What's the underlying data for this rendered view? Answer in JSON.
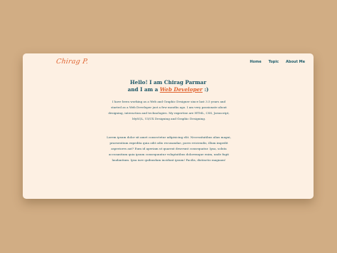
{
  "brand": {
    "logo": "Chirag P."
  },
  "nav": {
    "items": [
      "Home",
      "Topic",
      "About Me"
    ]
  },
  "hero": {
    "line1": "Hello! I am Chirag Parmar",
    "line2_prefix": "and I am a",
    "role": "Web Developer",
    "line2_suffix": ":)"
  },
  "content": {
    "paragraph1": "I have been working as a Web and Graphic Designer since last 3.5 years and started as a Web Developer just a few months ago. I am very passionate about designing, interaction and technologies. My expertise are HTML, CSS, Javascript, MySQL, UI/UX Designing and Graphic Designing.",
    "paragraph2": "Lorem ipsum dolor sit amet consectetur adipisicing elit. Necessitatibus alias magni, praesentium expedita quia odit odio recusandae, porro reiciendis, illum impedit asperiores aut? Eum id aperiam ut quaerat deserunt consequatur. Ipsa, soluta accusantium quia ipsum consequuntur voluptatibus doloremque enim, unde fugit laudantium. Ipsa iure quibusdam incidunt ipsum! Facilis, distinctio magnam!"
  },
  "colors": {
    "background": "#d1ad84",
    "card": "#fdf0e3",
    "text": "#1a5566",
    "accent": "#e0632f"
  }
}
